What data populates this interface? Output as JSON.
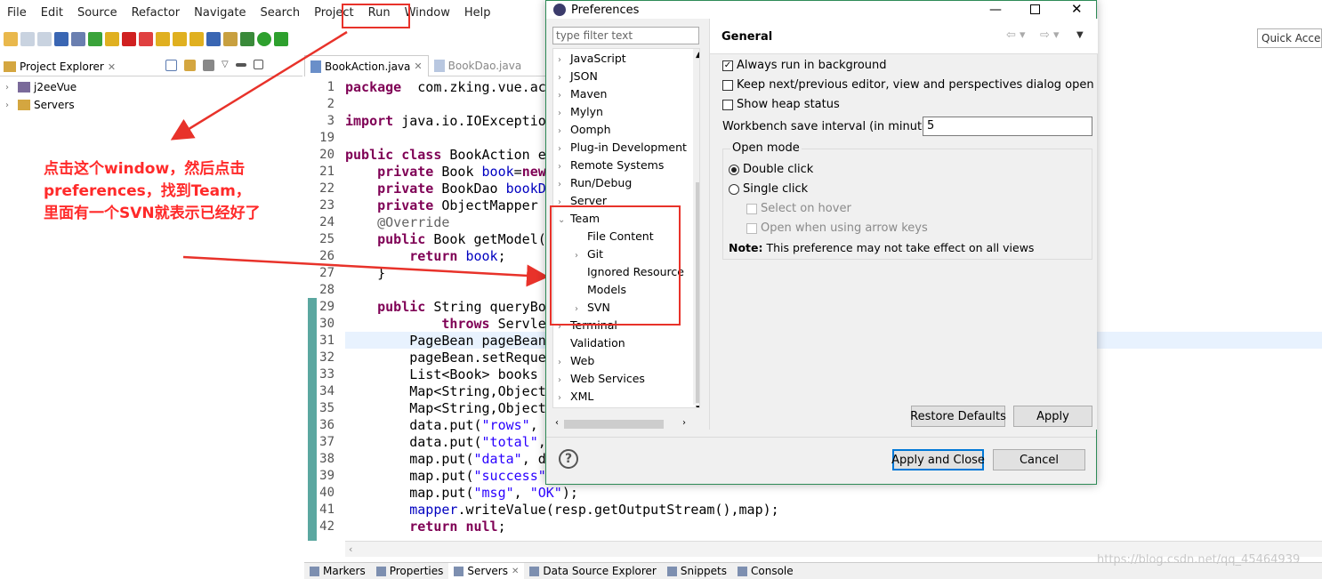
{
  "menu": [
    "File",
    "Edit",
    "Source",
    "Refactor",
    "Navigate",
    "Search",
    "Project",
    "Run",
    "Window",
    "Help"
  ],
  "quick_access": "Quick Access",
  "project_explorer": {
    "title": "Project Explorer",
    "items": [
      "j2eeVue",
      "Servers"
    ]
  },
  "editor": {
    "tabs": [
      "BookAction.java",
      "BookDao.java"
    ],
    "line_numbers": [
      "1",
      "2",
      "3",
      "19",
      "20",
      "21",
      "22",
      "23",
      "24",
      "25",
      "26",
      "27",
      "28",
      "29",
      "30",
      "31",
      "32",
      "33",
      "34",
      "35",
      "36",
      "37",
      "38",
      "39",
      "40",
      "41",
      "42"
    ],
    "lines": [
      [
        [
          "kw",
          "package"
        ],
        [
          "",
          "  com.zking.vue.act"
        ]
      ],
      [],
      [
        [
          "kw",
          "import"
        ],
        [
          "",
          " java.io.IOExceptio"
        ]
      ],
      [],
      [
        [
          "kw",
          "public class"
        ],
        [
          "",
          " BookAction e"
        ]
      ],
      [
        [
          "",
          "    "
        ],
        [
          "kw",
          "private"
        ],
        [
          "",
          " Book "
        ],
        [
          "fld",
          "book"
        ],
        [
          "",
          "="
        ],
        [
          "kw",
          "new"
        ]
      ],
      [
        [
          "",
          "    "
        ],
        [
          "kw",
          "private"
        ],
        [
          "",
          " BookDao "
        ],
        [
          "fld",
          "bookD"
        ]
      ],
      [
        [
          "",
          "    "
        ],
        [
          "kw",
          "private"
        ],
        [
          "",
          " ObjectMapper"
        ]
      ],
      [
        [
          "",
          "    "
        ],
        [
          "ann",
          "@Override"
        ]
      ],
      [
        [
          "",
          "    "
        ],
        [
          "kw",
          "public"
        ],
        [
          "",
          " Book getModel("
        ]
      ],
      [
        [
          "",
          "        "
        ],
        [
          "kw",
          "return"
        ],
        [
          "",
          " "
        ],
        [
          "fld",
          "book"
        ],
        [
          "",
          ";"
        ]
      ],
      [
        [
          "",
          "    }"
        ]
      ],
      [],
      [
        [
          "",
          "    "
        ],
        [
          "kw",
          "public"
        ],
        [
          "",
          " String queryBo"
        ]
      ],
      [
        [
          "",
          "            "
        ],
        [
          "kw",
          "throws"
        ],
        [
          "",
          " Servle"
        ]
      ],
      [
        [
          "",
          "        PageBean pageBean"
        ]
      ],
      [
        [
          "",
          "        pageBean.setReque"
        ]
      ],
      [
        [
          "",
          "        List<Book> books"
        ]
      ],
      [
        [
          "",
          "        Map<String,Object"
        ]
      ],
      [
        [
          "",
          "        Map<String,Object"
        ]
      ],
      [
        [
          "",
          "        data.put("
        ],
        [
          "str",
          "\"rows\""
        ],
        [
          "",
          ","
        ]
      ],
      [
        [
          "",
          "        data.put("
        ],
        [
          "str",
          "\"total\""
        ],
        [
          "",
          ","
        ]
      ],
      [
        [
          "",
          "        map.put("
        ],
        [
          "str",
          "\"data\""
        ],
        [
          "",
          ", d"
        ]
      ],
      [
        [
          "",
          "        map.put("
        ],
        [
          "str",
          "\"success\""
        ]
      ],
      [
        [
          "",
          "        map.put("
        ],
        [
          "str",
          "\"msg\""
        ],
        [
          "",
          ", "
        ],
        [
          "str",
          "\"OK\""
        ],
        [
          "",
          ");"
        ]
      ],
      [
        [
          "",
          "        "
        ],
        [
          "fld",
          "mapper"
        ],
        [
          "",
          ".writeValue(resp.getOutputStream(),map);"
        ]
      ],
      [
        [
          "",
          "        "
        ],
        [
          "kw",
          "return null"
        ],
        [
          "",
          ";"
        ]
      ]
    ]
  },
  "bottom_tabs": [
    "Markers",
    "Properties",
    "Servers",
    "Data Source Explorer",
    "Snippets",
    "Console"
  ],
  "watermark": "https://blog.csdn.net/qq_45464939",
  "annotation": {
    "lines": [
      "点击这个window，然后点击",
      "preferences，找到Team，",
      "里面有一个SVN就表示已经好了"
    ]
  },
  "dialog": {
    "title": "Preferences",
    "filter_placeholder": "type filter text",
    "tree": [
      {
        "label": "JavaScript",
        "exp": ">"
      },
      {
        "label": "JSON",
        "exp": ">"
      },
      {
        "label": "Maven",
        "exp": ">"
      },
      {
        "label": "Mylyn",
        "exp": ">"
      },
      {
        "label": "Oomph",
        "exp": ">"
      },
      {
        "label": "Plug-in Development",
        "exp": ">"
      },
      {
        "label": "Remote Systems",
        "exp": ">"
      },
      {
        "label": "Run/Debug",
        "exp": ">"
      },
      {
        "label": "Server",
        "exp": ">"
      },
      {
        "label": "Team",
        "exp": "v"
      },
      {
        "label": "File Content",
        "exp": "",
        "child": true
      },
      {
        "label": "Git",
        "exp": ">",
        "child": true
      },
      {
        "label": "Ignored Resource",
        "exp": "",
        "child": true
      },
      {
        "label": "Models",
        "exp": "",
        "child": true
      },
      {
        "label": "SVN",
        "exp": ">",
        "child": true
      },
      {
        "label": "Terminal",
        "exp": ">"
      },
      {
        "label": "Validation",
        "exp": ""
      },
      {
        "label": "Web",
        "exp": ">"
      },
      {
        "label": "Web Services",
        "exp": ">"
      },
      {
        "label": "XML",
        "exp": ">"
      }
    ],
    "page_title": "General",
    "always_run": "Always run in background",
    "keep_next": "Keep next/previous editor, view and perspectives dialog open",
    "show_heap": "Show heap status",
    "save_interval_label": "Workbench save interval (in minutes):",
    "save_interval_value": "5",
    "open_mode_label": "Open mode",
    "double_click": "Double click",
    "single_click": "Single click",
    "select_hover": "Select on hover",
    "open_arrow": "Open when using arrow keys",
    "note_bold": "Note:",
    "note_text": " This preference may not take effect on all views",
    "restore_defaults": "Restore Defaults",
    "apply": "Apply",
    "apply_close": "Apply and Close",
    "cancel": "Cancel"
  },
  "colors": {
    "highlight_box": "#e8322a",
    "arrow": "#e8322a",
    "dialog_border": "#2e8b57"
  }
}
